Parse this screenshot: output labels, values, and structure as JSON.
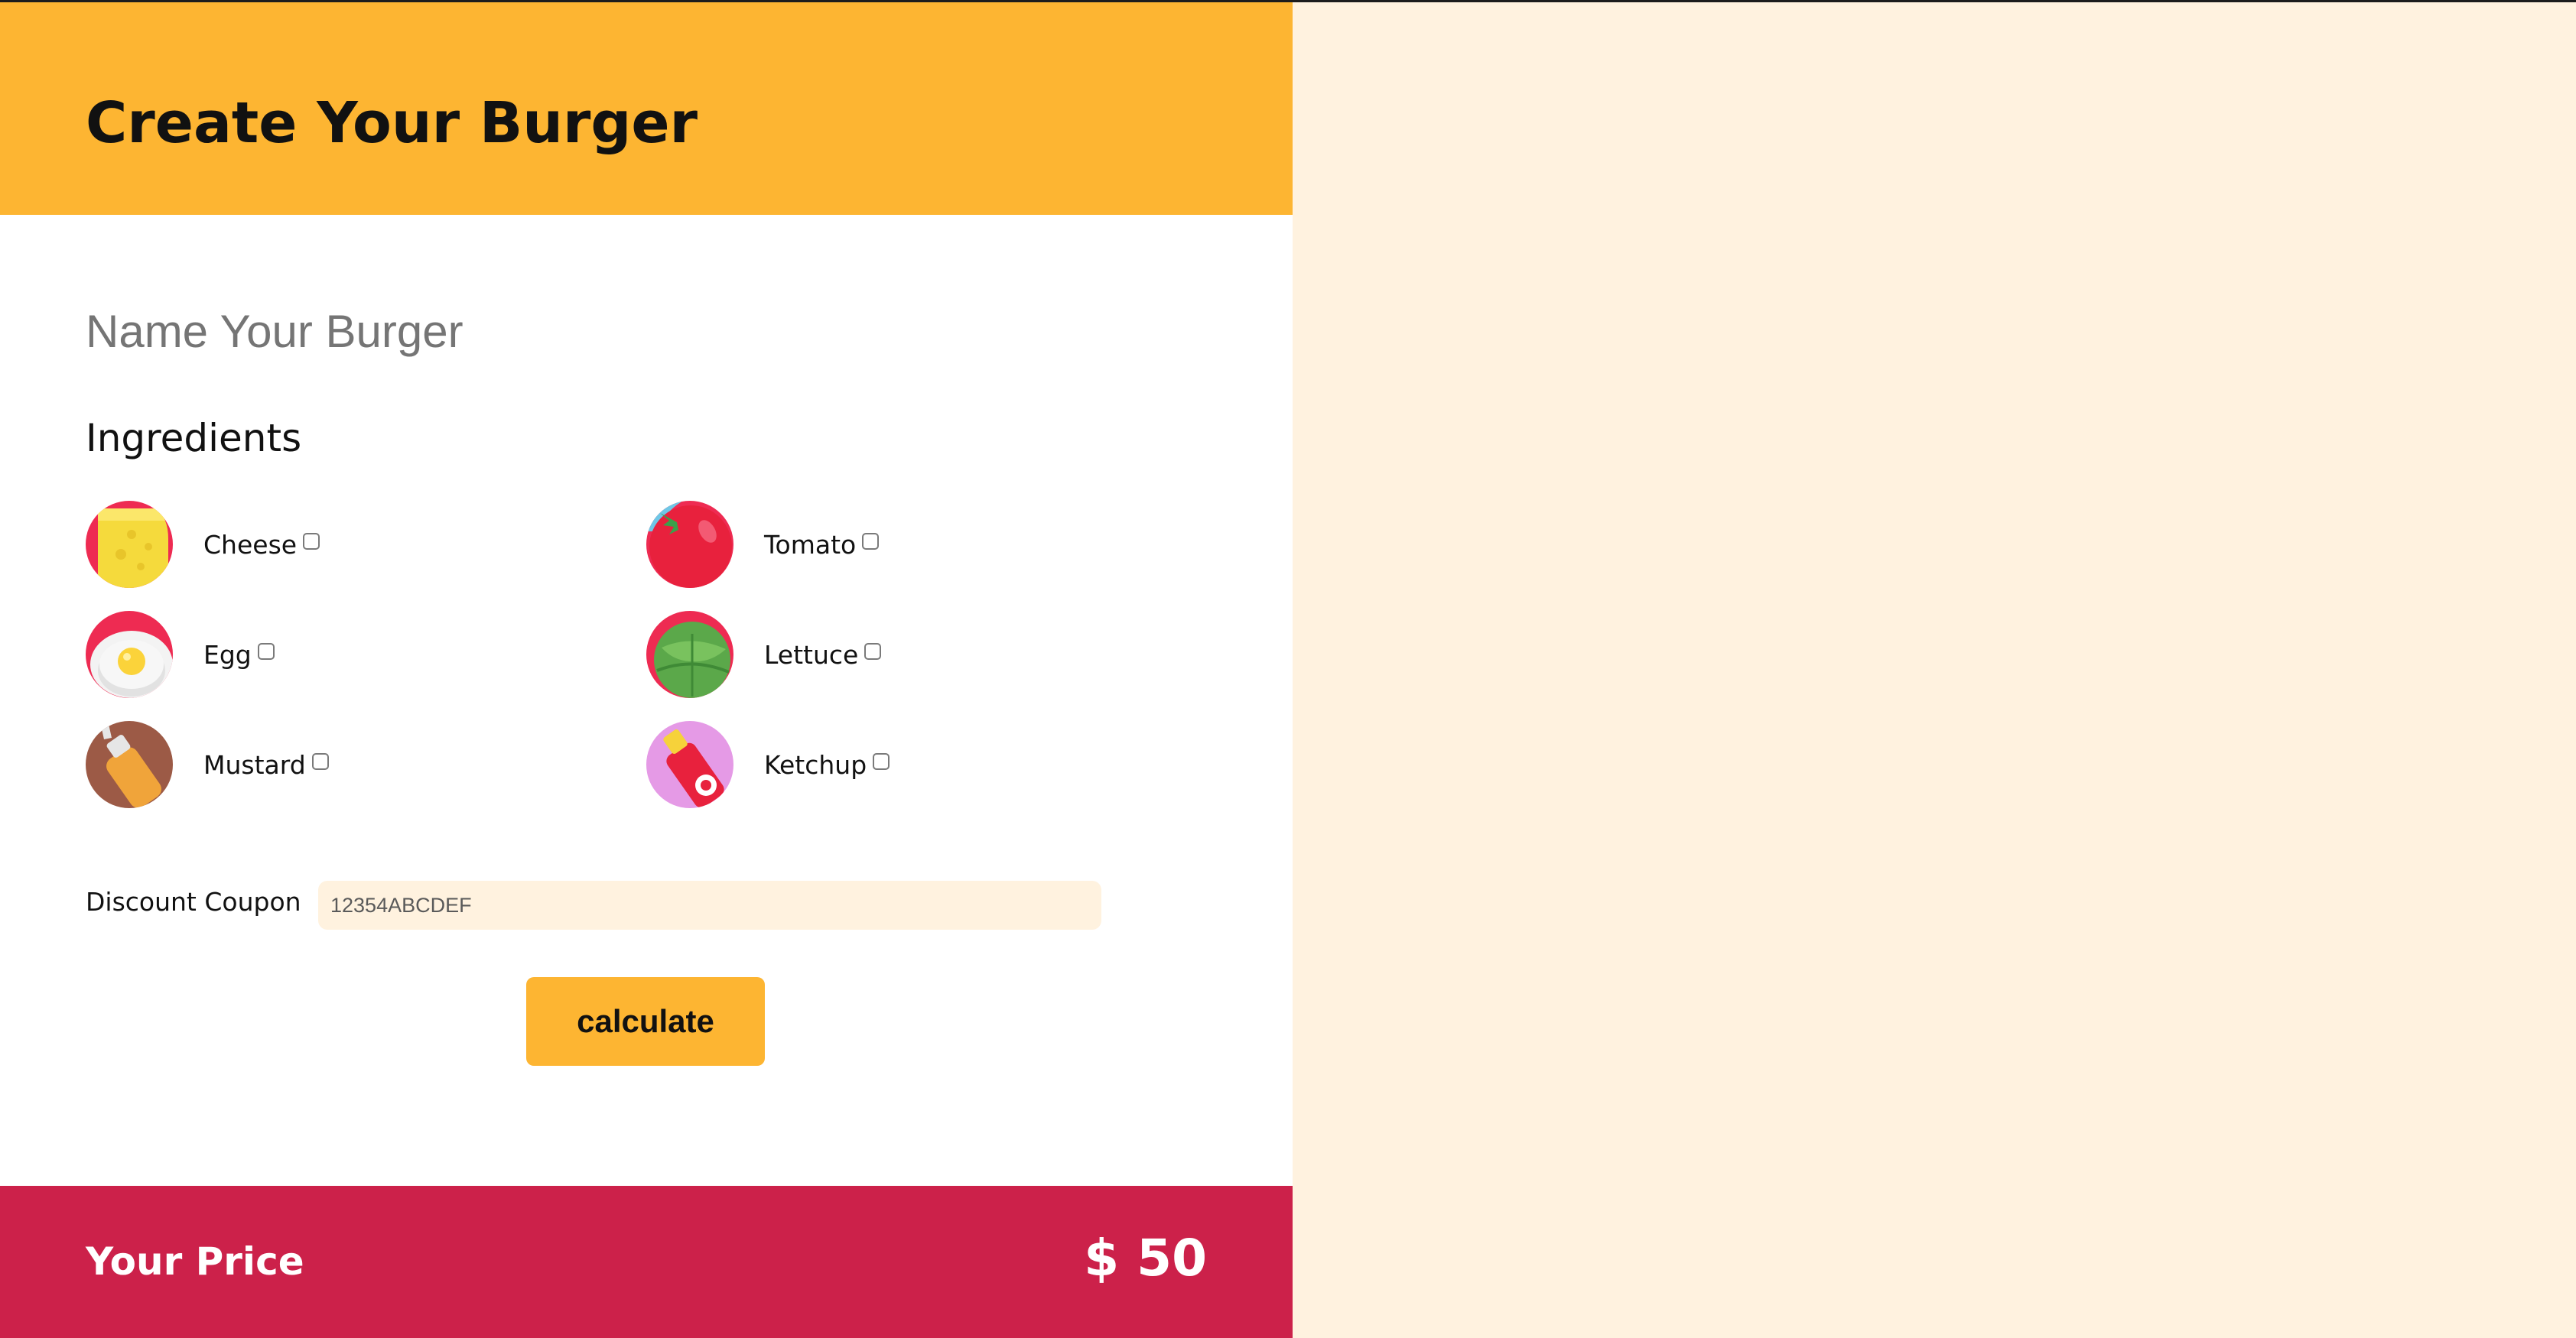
{
  "header": {
    "title": "Create Your Burger"
  },
  "form": {
    "name_placeholder": "Name Your Burger",
    "ingredients_heading": "Ingredients",
    "ingredients": [
      {
        "label": "Cheese",
        "icon": "cheese-icon",
        "checked": false
      },
      {
        "label": "Tomato",
        "icon": "tomato-icon",
        "checked": false
      },
      {
        "label": "Egg",
        "icon": "egg-icon",
        "checked": false
      },
      {
        "label": "Lettuce",
        "icon": "lettuce-icon",
        "checked": false
      },
      {
        "label": "Mustard",
        "icon": "mustard-icon",
        "checked": false
      },
      {
        "label": "Ketchup",
        "icon": "ketchup-icon",
        "checked": false
      }
    ],
    "coupon_label": "Discount Coupon",
    "coupon_value": "12354ABCDEF",
    "calculate_label": "calculate"
  },
  "price": {
    "label": "Your Price",
    "value": "$ 50"
  },
  "colors": {
    "header_bg": "#fdb532",
    "price_bg": "#cc214a",
    "page_bg": "#fff2df",
    "button_bg": "#fdb532"
  }
}
